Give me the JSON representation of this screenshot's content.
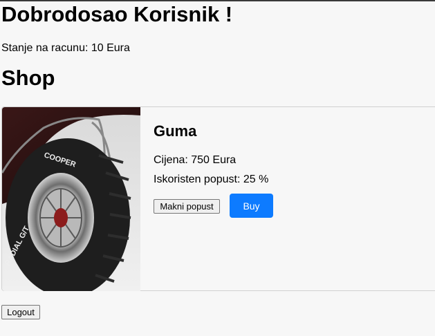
{
  "header": {
    "welcome": "Dobrodosao Korisnik !",
    "balance": "Stanje na racunu: 10 Eura"
  },
  "shop": {
    "title": "Shop",
    "products": [
      {
        "name": "Guma",
        "price": "Cijena: 750 Eura",
        "discount": "Iskoristen popust: 25 %",
        "remove_discount_label": "Makni popust",
        "buy_label": "Buy",
        "image_text": "COOPER RADIAL G/T"
      }
    ]
  },
  "footer": {
    "logout_label": "Logout"
  },
  "colors": {
    "accent": "#0d7bff",
    "background": "#f7f7f7"
  }
}
